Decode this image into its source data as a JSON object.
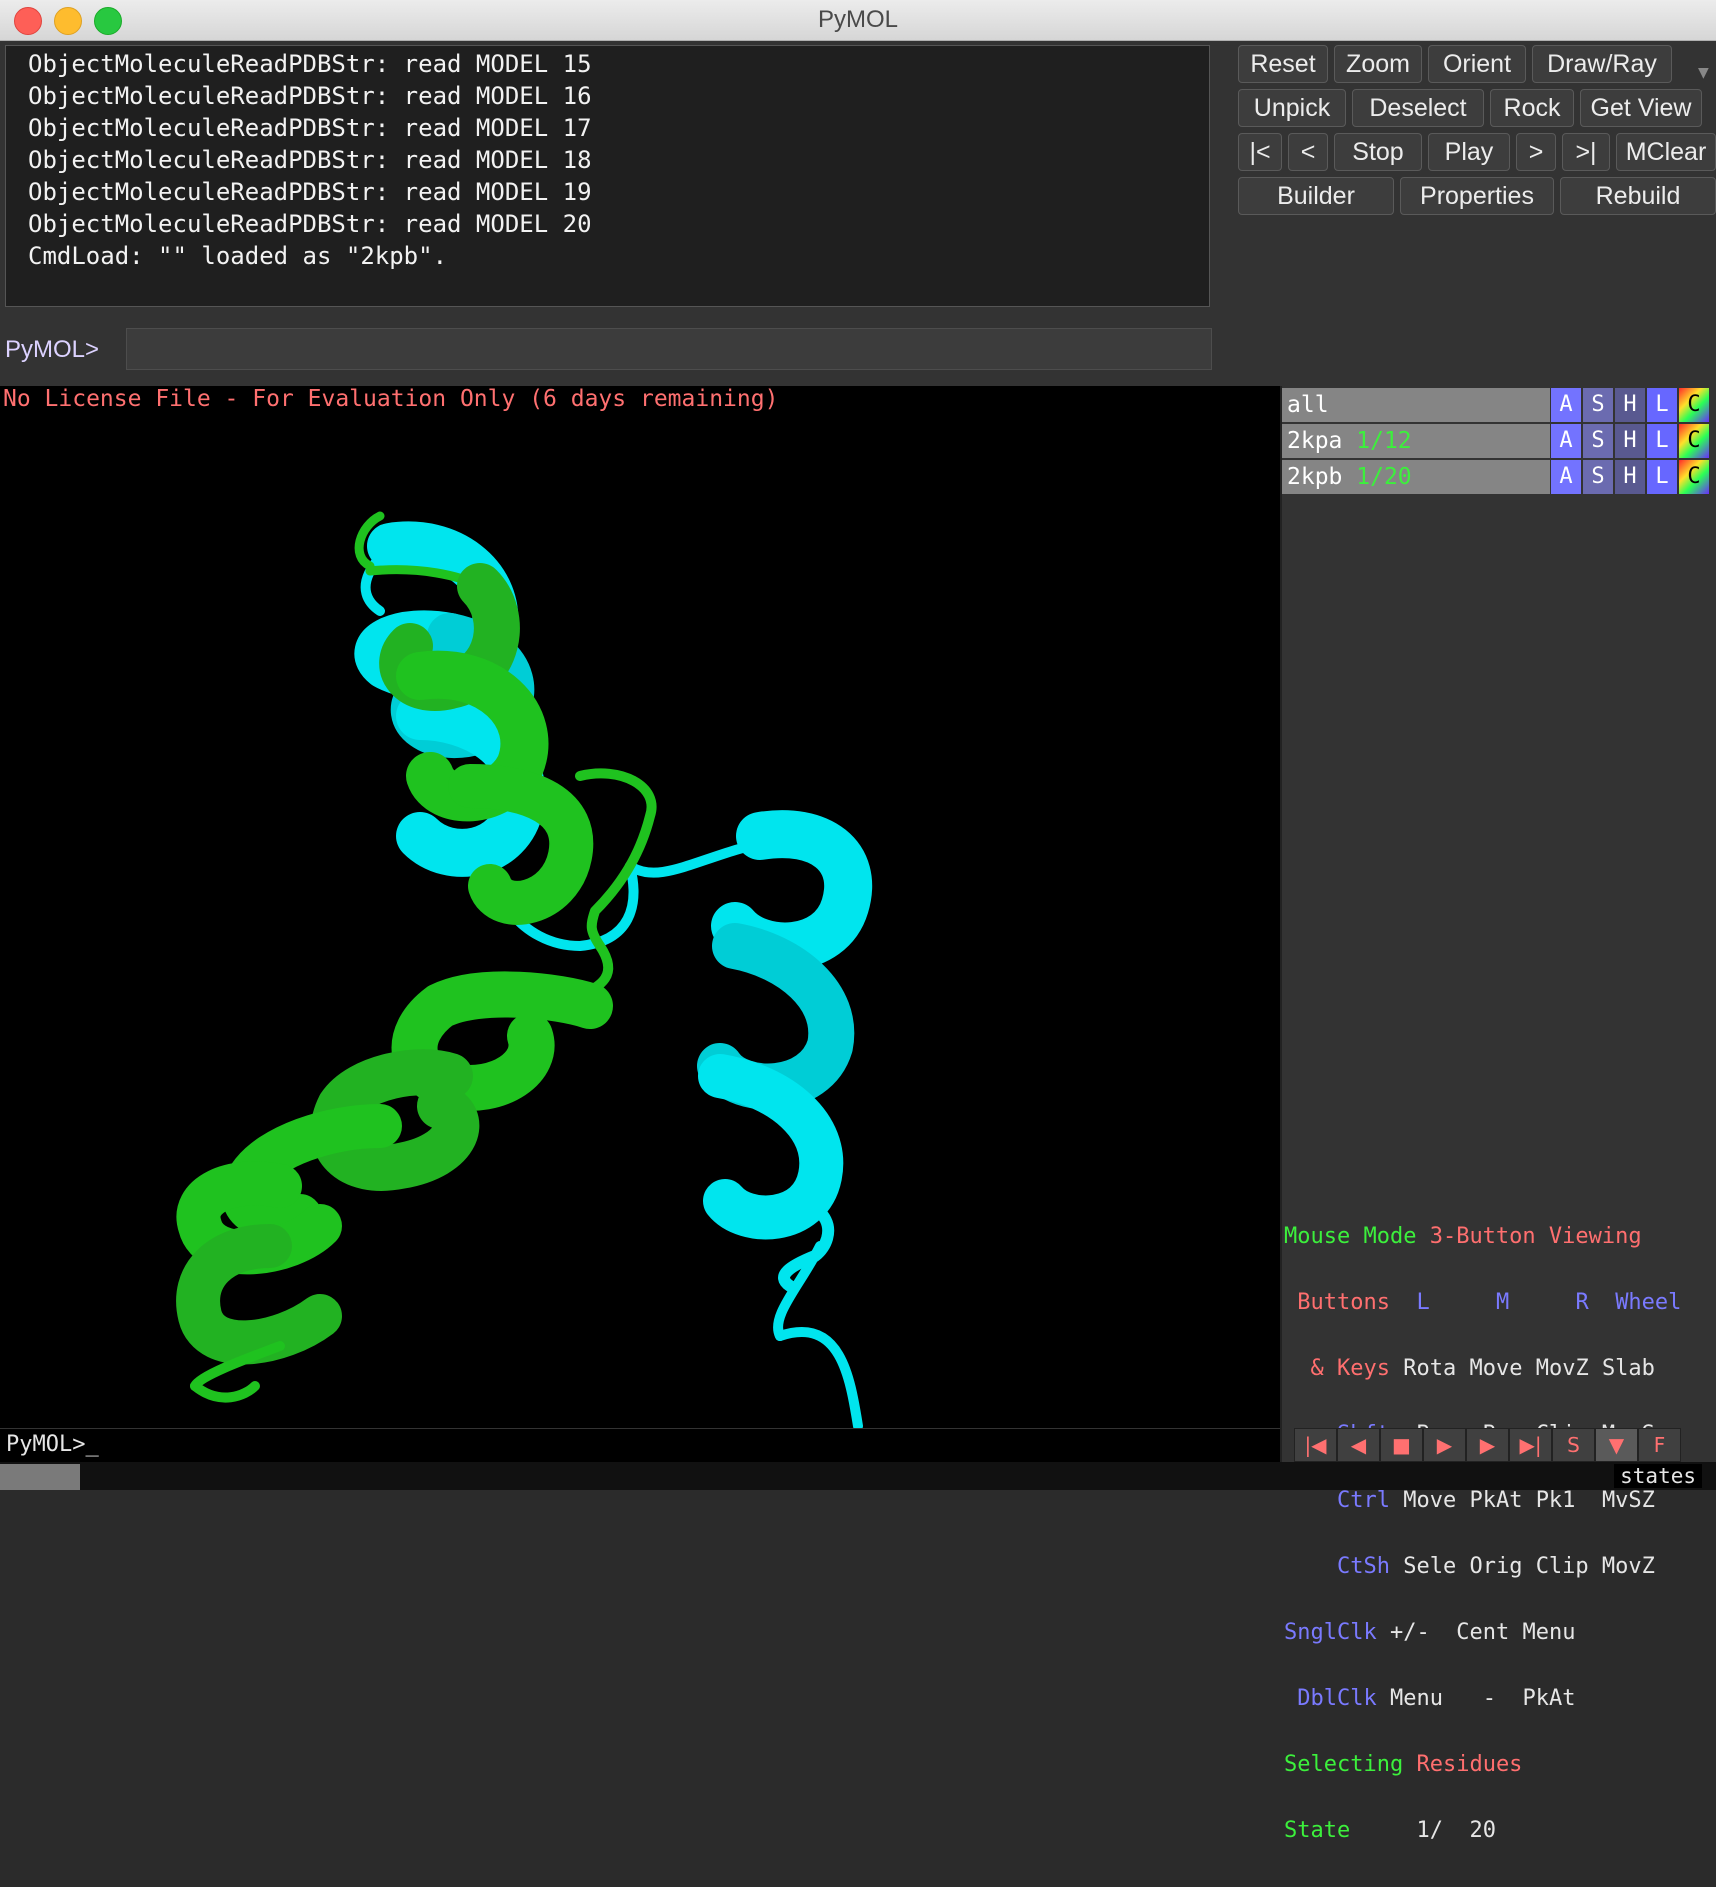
{
  "window": {
    "title": "PyMOL"
  },
  "log": {
    "lines": [
      "ObjectMoleculeReadPDBStr: read MODEL 15",
      "ObjectMoleculeReadPDBStr: read MODEL 16",
      "ObjectMoleculeReadPDBStr: read MODEL 17",
      "ObjectMoleculeReadPDBStr: read MODEL 18",
      "ObjectMoleculeReadPDBStr: read MODEL 19",
      "ObjectMoleculeReadPDBStr: read MODEL 20",
      "CmdLoad: \"\" loaded as \"2kpb\"."
    ]
  },
  "command": {
    "prompt": "PyMOL>",
    "value": ""
  },
  "buttons": {
    "row1": [
      "Reset",
      "Zoom",
      "Orient",
      "Draw/Ray"
    ],
    "row2": [
      "Unpick",
      "Deselect",
      "Rock",
      "Get View"
    ],
    "row3": [
      "|<",
      "<",
      "Stop",
      "Play",
      ">",
      ">|",
      "MClear"
    ],
    "row4": [
      "Builder",
      "Properties",
      "Rebuild"
    ]
  },
  "viewer": {
    "license_notice": "No License File - For Evaluation Only (6 days remaining)"
  },
  "objects": [
    {
      "name": "all",
      "state": "",
      "buttons": [
        "A",
        "S",
        "H",
        "L",
        "C"
      ]
    },
    {
      "name": "2kpa",
      "state": "1/12",
      "buttons": [
        "A",
        "S",
        "H",
        "L",
        "C"
      ]
    },
    {
      "name": "2kpb",
      "state": "1/20",
      "buttons": [
        "A",
        "S",
        "H",
        "L",
        "C"
      ]
    }
  ],
  "mouse_info": {
    "mode_label": "Mouse Mode",
    "mode_value": "3-Button Viewing",
    "buttons_label": "Buttons",
    "cols": [
      "L",
      "M",
      "R",
      "Wheel"
    ],
    "keys_label": "& Keys",
    "keys_values": [
      "Rota",
      "Move",
      "MovZ",
      "Slab"
    ],
    "shft_label": "Shft",
    "shft_values": [
      "+Box",
      "-Box",
      "Clip",
      "MovS"
    ],
    "ctrl_label": "Ctrl",
    "ctrl_values": [
      "Move",
      "PkAt",
      "Pk1",
      "MvSZ"
    ],
    "ctsh_label": "CtSh",
    "ctsh_values": [
      "Sele",
      "Orig",
      "Clip",
      "MovZ"
    ],
    "sngl_label": "SnglClk",
    "sngl_values": [
      "+/-",
      "Cent",
      "Menu"
    ],
    "dbl_label": "DblClk",
    "dbl_values": [
      "Menu",
      "-",
      "PkAt"
    ],
    "selecting_label": "Selecting",
    "selecting_value": "Residues",
    "state_label": "State",
    "state_current": "1/",
    "state_total": "20"
  },
  "bottom_prompt": "PyMOL>_",
  "transport": [
    "|◀",
    "◀",
    "■",
    "▶",
    "▶",
    "▶|",
    "S",
    "▼",
    "F"
  ],
  "states_label": "states",
  "colors": {
    "cyan_chain": "#00e5ee",
    "green_chain": "#1fc21f",
    "license_text": "#ff7070",
    "object_state": "#3cf03c"
  }
}
